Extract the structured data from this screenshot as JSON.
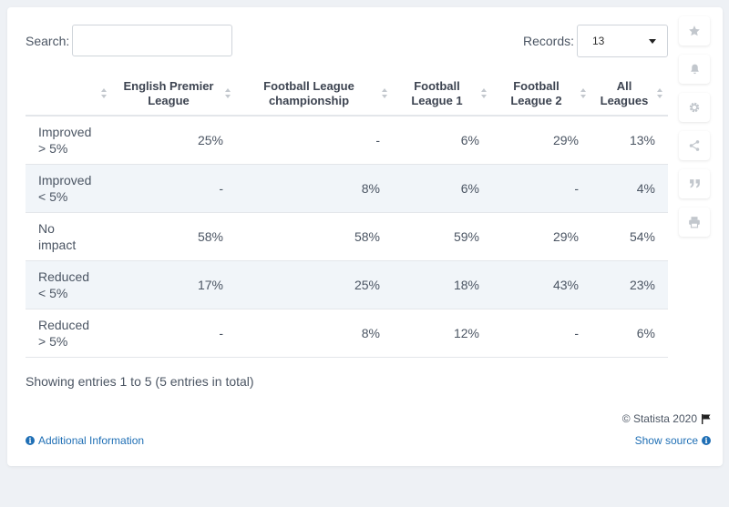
{
  "search": {
    "label": "Search:",
    "placeholder": ""
  },
  "records": {
    "label": "Records:",
    "value": "13"
  },
  "table": {
    "columns": [
      "",
      "English Premier League",
      "Football League championship",
      "Football League 1",
      "Football League 2",
      "All Leagues"
    ],
    "column_lines": [
      [
        "",
        ""
      ],
      [
        "English Premier",
        "League"
      ],
      [
        "Football League",
        "championship"
      ],
      [
        "Football",
        "League 1"
      ],
      [
        "Football",
        "League 2"
      ],
      [
        "All",
        "Leagues"
      ]
    ],
    "rows": [
      {
        "label": [
          "Improved",
          "> 5%"
        ],
        "cells": [
          "25%",
          "-",
          "6%",
          "29%",
          "13%"
        ]
      },
      {
        "label": [
          "Improved",
          "< 5%"
        ],
        "cells": [
          "-",
          "8%",
          "6%",
          "-",
          "4%"
        ]
      },
      {
        "label": [
          "No",
          "impact"
        ],
        "cells": [
          "58%",
          "58%",
          "59%",
          "29%",
          "54%"
        ]
      },
      {
        "label": [
          "Reduced",
          "< 5%"
        ],
        "cells": [
          "17%",
          "25%",
          "18%",
          "43%",
          "23%"
        ]
      },
      {
        "label": [
          "Reduced",
          "> 5%"
        ],
        "cells": [
          "-",
          "8%",
          "12%",
          "-",
          "6%"
        ]
      }
    ]
  },
  "summary": "Showing entries 1 to 5 (5 entries in total)",
  "footer": {
    "copyright": "© Statista 2020",
    "additional_info": "Additional Information",
    "show_source": "Show source"
  },
  "side_tools": [
    "star-icon",
    "bell-icon",
    "gear-icon",
    "share-icon",
    "quote-icon",
    "print-icon"
  ],
  "colors": {
    "link": "#1f6fb5",
    "alt_row": "#f1f5f9",
    "text": "#4b5563"
  },
  "chart_data": {
    "type": "table",
    "columns": [
      "English Premier League",
      "Football League championship",
      "Football League 1",
      "Football League 2",
      "All Leagues"
    ],
    "rows": [
      {
        "category": "Improved > 5%",
        "values": [
          "25%",
          "-",
          "6%",
          "29%",
          "13%"
        ]
      },
      {
        "category": "Improved < 5%",
        "values": [
          "-",
          "8%",
          "6%",
          "-",
          "4%"
        ]
      },
      {
        "category": "No impact",
        "values": [
          "58%",
          "58%",
          "59%",
          "29%",
          "54%"
        ]
      },
      {
        "category": "Reduced < 5%",
        "values": [
          "17%",
          "25%",
          "18%",
          "43%",
          "23%"
        ]
      },
      {
        "category": "Reduced > 5%",
        "values": [
          "-",
          "8%",
          "12%",
          "-",
          "6%"
        ]
      }
    ]
  }
}
